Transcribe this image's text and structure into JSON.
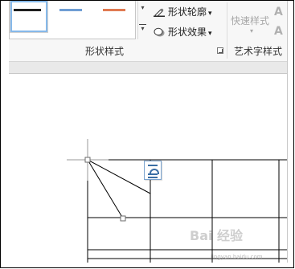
{
  "ribbon": {
    "shape_styles": {
      "outline_label": "形状轮廓",
      "effect_label": "形状效果",
      "group_label": "形状样式",
      "dropdown_glyph": "▾"
    },
    "wordart": {
      "quick_styles_label": "快速样式",
      "group_label": "艺术字样式",
      "glyph_a": "A"
    }
  },
  "watermark": {
    "text": "Bai 经验",
    "url": "jingyan.baidu.com"
  },
  "colors": {
    "swatch_1": "#1f1f1f",
    "swatch_2": "#6f9ed4",
    "swatch_3": "#e07a52",
    "selection": "#86b9ea"
  },
  "icons": [
    "pen-outline-icon",
    "shape-effect-icon",
    "layout-options-icon",
    "dialog-launcher-icon"
  ]
}
